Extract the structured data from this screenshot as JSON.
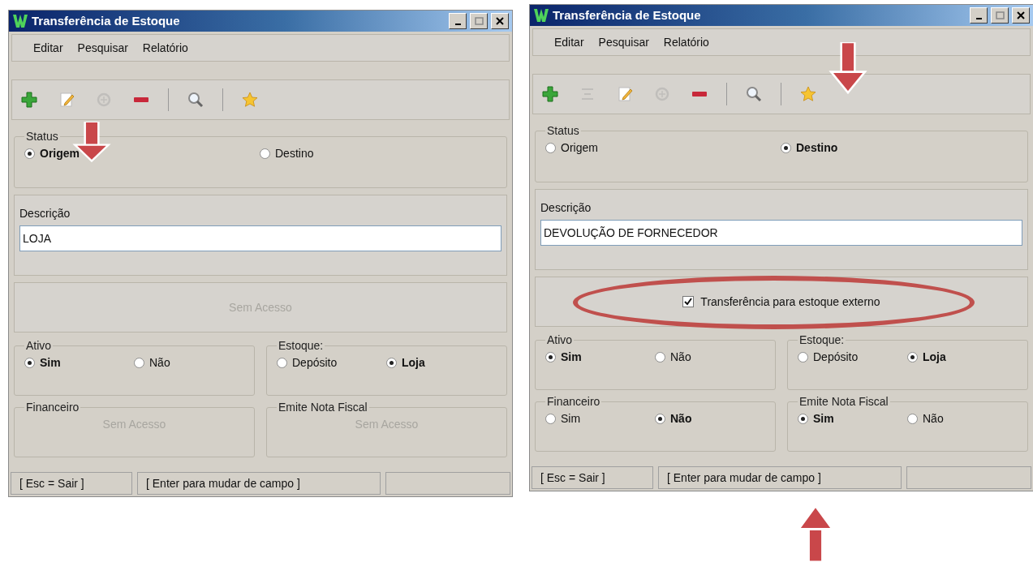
{
  "windows": [
    {
      "title": "Transferência de Estoque",
      "menu": [
        "Editar",
        "Pesquisar",
        "Relatório"
      ],
      "toolbar": [
        {
          "kind": "add",
          "disabled": false
        },
        {
          "kind": "edit",
          "disabled": false
        },
        {
          "kind": "reload",
          "disabled": true
        },
        {
          "kind": "remove",
          "disabled": false
        },
        {
          "kind": "separator"
        },
        {
          "kind": "search",
          "disabled": false
        },
        {
          "kind": "separator"
        },
        {
          "kind": "favorite",
          "disabled": false
        }
      ],
      "status": {
        "legend": "Status",
        "options": [
          {
            "label": "Origem",
            "selected": true
          },
          {
            "label": "Destino",
            "selected": false
          }
        ]
      },
      "description": {
        "label": "Descrição",
        "value": "LOJA"
      },
      "access": {
        "kind": "text",
        "text": "Sem Acesso"
      },
      "groups": [
        {
          "legend": "Ativo",
          "kind": "radio",
          "options": [
            {
              "label": "Sim",
              "selected": true
            },
            {
              "label": "Não",
              "selected": false
            }
          ]
        },
        {
          "legend": "Estoque:",
          "kind": "radio",
          "options": [
            {
              "label": "Depósito",
              "selected": false
            },
            {
              "label": "Loja",
              "selected": true
            }
          ]
        },
        {
          "legend": "Financeiro",
          "kind": "text",
          "text": "Sem Acesso"
        },
        {
          "legend": "Emite Nota Fiscal",
          "kind": "text",
          "text": "Sem Acesso"
        }
      ],
      "status_bar": [
        "[ Esc = Sair ]",
        "[ Enter para mudar de campo ]"
      ]
    },
    {
      "title": "Transferência de Estoque",
      "menu": [
        "Editar",
        "Pesquisar",
        "Relatório"
      ],
      "toolbar": [
        {
          "kind": "add",
          "disabled": false
        },
        {
          "kind": "align",
          "disabled": true
        },
        {
          "kind": "edit",
          "disabled": false
        },
        {
          "kind": "reload",
          "disabled": true
        },
        {
          "kind": "remove",
          "disabled": false
        },
        {
          "kind": "separator"
        },
        {
          "kind": "search",
          "disabled": false
        },
        {
          "kind": "separator"
        },
        {
          "kind": "favorite",
          "disabled": false
        }
      ],
      "status": {
        "legend": "Status",
        "options": [
          {
            "label": "Origem",
            "selected": false
          },
          {
            "label": "Destino",
            "selected": true
          }
        ]
      },
      "description": {
        "label": "Descrição",
        "value": "DEVOLUÇÃO DE FORNECEDOR"
      },
      "access": {
        "kind": "checkbox",
        "label": "Transferência para estoque externo",
        "checked": true
      },
      "groups": [
        {
          "legend": "Ativo",
          "kind": "radio",
          "options": [
            {
              "label": "Sim",
              "selected": true
            },
            {
              "label": "Não",
              "selected": false
            }
          ]
        },
        {
          "legend": "Estoque:",
          "kind": "radio",
          "options": [
            {
              "label": "Depósito",
              "selected": false
            },
            {
              "label": "Loja",
              "selected": true
            }
          ]
        },
        {
          "legend": "Financeiro",
          "kind": "radio",
          "options": [
            {
              "label": "Sim",
              "selected": false
            },
            {
              "label": "Não",
              "selected": true
            }
          ]
        },
        {
          "legend": "Emite Nota Fiscal",
          "kind": "radio",
          "options": [
            {
              "label": "Sim",
              "selected": true
            },
            {
              "label": "Não",
              "selected": false
            }
          ]
        }
      ],
      "status_bar": [
        "[ Esc = Sair ]",
        "[ Enter para mudar de campo ]"
      ]
    }
  ]
}
